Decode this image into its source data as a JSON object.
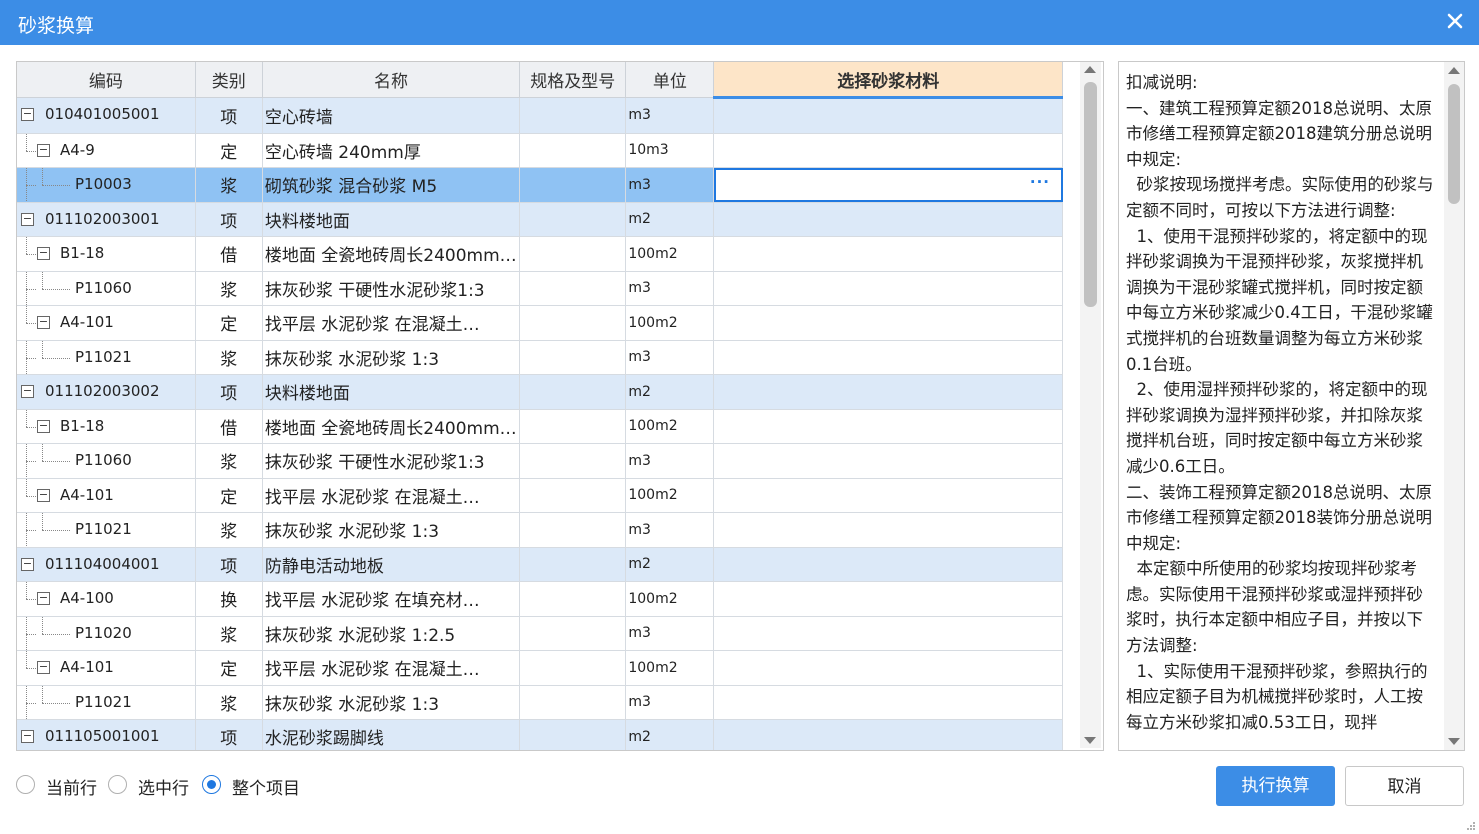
{
  "window": {
    "title": "砂浆换算"
  },
  "grid": {
    "columns": [
      "编码",
      "类别",
      "名称",
      "规格及型号",
      "单位",
      "选择砂浆材料"
    ],
    "rows": [
      {
        "code": "010401005001",
        "cat": "项",
        "name": "空心砖墙",
        "spec": "",
        "unit": "m3",
        "level": 0,
        "toggle": "−"
      },
      {
        "code": "A4-9",
        "cat": "定",
        "name": "空心砖墙 240mm厚",
        "spec": "",
        "unit": "10m3",
        "level": 1,
        "toggle": "−"
      },
      {
        "code": "P10003",
        "cat": "浆",
        "name": "砌筑砂浆 混合砂浆 M5",
        "spec": "",
        "unit": "m3",
        "level": 2,
        "active": true,
        "ellipsis": "···"
      },
      {
        "code": "011102003001",
        "cat": "项",
        "name": "块料楼地面",
        "spec": "",
        "unit": "m2",
        "level": 0,
        "toggle": "−"
      },
      {
        "code": "B1-18",
        "cat": "借",
        "name": "楼地面 全瓷地砖周长2400mm…",
        "spec": "",
        "unit": "100m2",
        "level": 1,
        "toggle": "−"
      },
      {
        "code": "P11060",
        "cat": "浆",
        "name": "抹灰砂浆 干硬性水泥砂浆1:3",
        "spec": "",
        "unit": "m3",
        "level": 2
      },
      {
        "code": "A4-101",
        "cat": "定",
        "name": "找平层 水泥砂浆 在混凝土…",
        "spec": "",
        "unit": "100m2",
        "level": 1,
        "toggle": "−"
      },
      {
        "code": "P11021",
        "cat": "浆",
        "name": "抹灰砂浆 水泥砂浆 1:3",
        "spec": "",
        "unit": "m3",
        "level": 2
      },
      {
        "code": "011102003002",
        "cat": "项",
        "name": "块料楼地面",
        "spec": "",
        "unit": "m2",
        "level": 0,
        "toggle": "−"
      },
      {
        "code": "B1-18",
        "cat": "借",
        "name": "楼地面 全瓷地砖周长2400mm…",
        "spec": "",
        "unit": "100m2",
        "level": 1,
        "toggle": "−"
      },
      {
        "code": "P11060",
        "cat": "浆",
        "name": "抹灰砂浆 干硬性水泥砂浆1:3",
        "spec": "",
        "unit": "m3",
        "level": 2
      },
      {
        "code": "A4-101",
        "cat": "定",
        "name": "找平层 水泥砂浆 在混凝土…",
        "spec": "",
        "unit": "100m2",
        "level": 1,
        "toggle": "−"
      },
      {
        "code": "P11021",
        "cat": "浆",
        "name": "抹灰砂浆 水泥砂浆 1:3",
        "spec": "",
        "unit": "m3",
        "level": 2
      },
      {
        "code": "011104004001",
        "cat": "项",
        "name": "防静电活动地板",
        "spec": "",
        "unit": "m2",
        "level": 0,
        "toggle": "−"
      },
      {
        "code": "A4-100",
        "cat": "换",
        "name": "找平层 水泥砂浆 在填充材…",
        "spec": "",
        "unit": "100m2",
        "level": 1,
        "toggle": "−"
      },
      {
        "code": "P11020",
        "cat": "浆",
        "name": "抹灰砂浆 水泥砂浆 1:2.5",
        "spec": "",
        "unit": "m3",
        "level": 2
      },
      {
        "code": "A4-101",
        "cat": "定",
        "name": "找平层 水泥砂浆 在混凝土…",
        "spec": "",
        "unit": "100m2",
        "level": 1,
        "toggle": "−"
      },
      {
        "code": "P11021",
        "cat": "浆",
        "name": "抹灰砂浆 水泥砂浆 1:3",
        "spec": "",
        "unit": "m3",
        "level": 2
      },
      {
        "code": "011105001001",
        "cat": "项",
        "name": "水泥砂浆踢脚线",
        "spec": "",
        "unit": "m2",
        "level": 0,
        "toggle": "−"
      }
    ]
  },
  "notes": {
    "text": "扣减说明:\n一、建筑工程预算定额2018总说明、太原市修缮工程预算定额2018建筑分册总说明中规定:\n  砂浆按现场搅拌考虑。实际使用的砂浆与定额不同时，可按以下方法进行调整:\n  1、使用干混预拌砂浆的，将定额中的现拌砂浆调换为干混预拌砂浆，灰浆搅拌机调换为干混砂浆罐式搅拌机，同时按定额中每立方米砂浆减少0.4工日，干混砂浆罐式搅拌机的台班数量调整为每立方米砂浆0.1台班。\n  2、使用湿拌预拌砂浆的，将定额中的现拌砂浆调换为湿拌预拌砂浆，并扣除灰浆搅拌机台班，同时按定额中每立方米砂浆减少0.6工日。\n二、装饰工程预算定额2018总说明、太原市修缮工程预算定额2018装饰分册总说明中规定:\n  本定额中所使用的砂浆均按现拌砂浆考虑。实际使用干混预拌砂浆或湿拌预拌砂浆时，执行本定额中相应子目，并按以下方法调整:\n  1、实际使用干混预拌砂浆，参照执行的相应定额子目为机械搅拌砂浆时，人工按每立方米砂浆扣减0.53工日，现拌"
  },
  "scope": {
    "options": [
      "当前行",
      "选中行",
      "整个项目"
    ],
    "selected": "整个项目"
  },
  "buttons": {
    "execute": "执行换算",
    "cancel": "取消"
  },
  "colors": {
    "accent": "#3c8de6",
    "row_item": "#dce9f8",
    "row_active": "#8fc2f3",
    "header_selected": "#fde5c8"
  }
}
